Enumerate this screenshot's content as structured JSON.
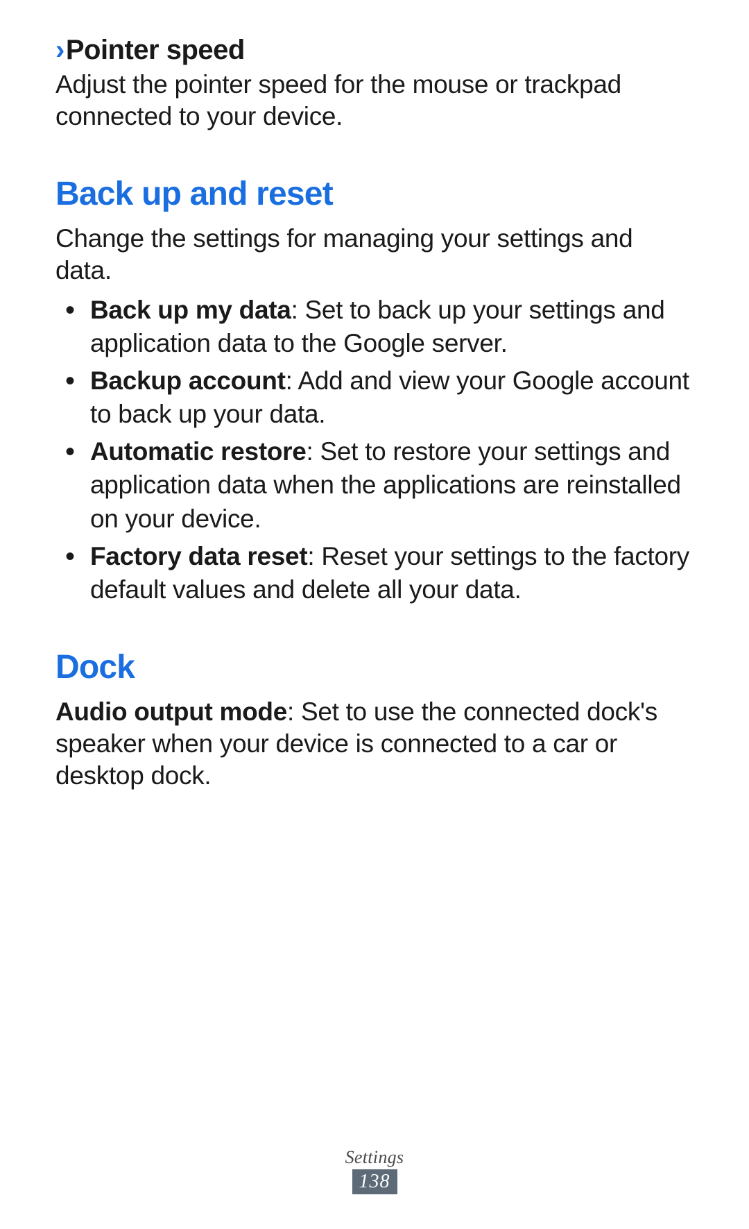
{
  "pointer_speed": {
    "heading": "Pointer speed",
    "body": "Adjust the pointer speed for the mouse or trackpad connected to your device."
  },
  "backup_reset": {
    "heading": "Back up and reset",
    "intro": "Change the settings for managing your settings and data.",
    "items": [
      {
        "term": "Back up my data",
        "desc": ": Set to back up your settings and application data to the Google server."
      },
      {
        "term": "Backup account",
        "desc": ": Add and view your Google account to back up your data."
      },
      {
        "term": "Automatic restore",
        "desc": ": Set to restore your settings and application data when the applications are reinstalled on your device."
      },
      {
        "term": "Factory data reset",
        "desc": ": Reset your settings to the factory default values and delete all your data."
      }
    ]
  },
  "dock": {
    "heading": "Dock",
    "term": "Audio output mode",
    "desc": ": Set to use the connected dock's speaker when your device is connected to a car or desktop dock."
  },
  "footer": {
    "section": "Settings",
    "page": "138"
  }
}
